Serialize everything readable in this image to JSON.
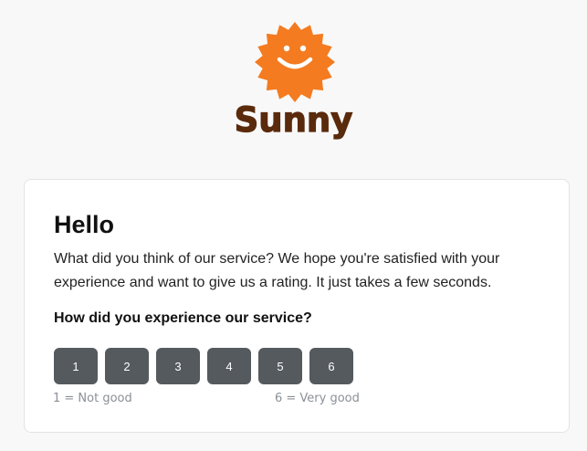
{
  "brand": {
    "name": "Sunny",
    "logo_icon": "sun-smiley-icon",
    "logo_color": "#f47b20",
    "wordmark_color": "#5a2a0c"
  },
  "survey": {
    "title": "Hello",
    "intro": "What did you think of our service? We hope you're satisfied with your experience and want to give us a rating. It just takes a few seconds.",
    "question": "How did you experience our service?",
    "ratings": [
      "1",
      "2",
      "3",
      "4",
      "5",
      "6"
    ],
    "scale_low": "1 = Not good",
    "scale_high": "6 = Very good",
    "button_color": "#555a5e"
  }
}
